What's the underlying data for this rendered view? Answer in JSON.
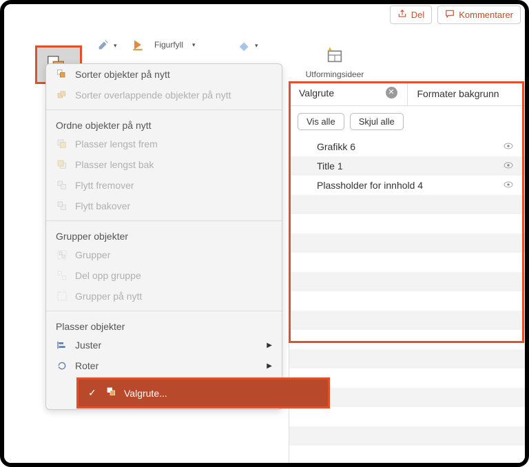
{
  "top": {
    "share": "Del",
    "comments": "Kommentarer"
  },
  "ribbon": {
    "figurfyll": "Figurfyll",
    "designer": "Utformingsideer"
  },
  "dropdown": {
    "sort1": "Sorter objekter på nytt",
    "sort2": "Sorter overlappende objekter på nytt",
    "sec1": "Ordne objekter på nytt",
    "i1": "Plasser lengst frem",
    "i2": "Plasser lengst bak",
    "i3": "Flytt fremover",
    "i4": "Flytt bakover",
    "sec2": "Grupper objekter",
    "g1": "Grupper",
    "g2": "Del opp gruppe",
    "g3": "Grupper på nytt",
    "sec3": "Plasser objekter",
    "p1": "Juster",
    "p2": "Roter",
    "active": "Valgrute..."
  },
  "panel": {
    "tab1": "Valgrute",
    "tab2": "Formater bakgrunn",
    "showAll": "Vis alle",
    "hideAll": "Skjul alle",
    "rows": {
      "r0": "Grafikk 6",
      "r1": "Title 1",
      "r2": "Plassholder for innhold 4"
    }
  }
}
